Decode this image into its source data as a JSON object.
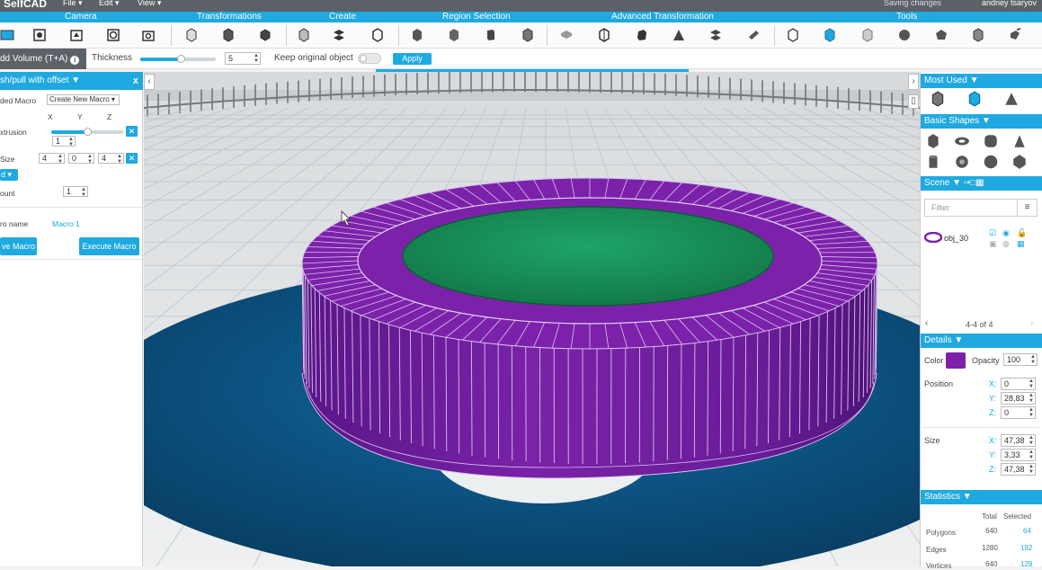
{
  "app": {
    "logo": "SelfCAD",
    "menus": [
      "File ▾",
      "Edit ▾",
      "View ▾"
    ],
    "saving": "Saving changes",
    "user": "andriey tsaryov"
  },
  "sections": [
    "Camera",
    "Transformations",
    "Create",
    "Region Selection",
    "Advanced Transformation",
    "Tools"
  ],
  "optbar": {
    "mode": "dd Volume (T+A)",
    "thickness_label": "Thickness",
    "thickness_value": "5",
    "keep_label": "Keep original object",
    "apply_label": "Apply"
  },
  "left": {
    "title": "sh/pull with offset ▼",
    "close": "x",
    "macro_label": "ded Macro",
    "macro_select": "Create New Macro ▾",
    "axes": [
      "X",
      "Y",
      "Z"
    ],
    "extrusion_label": "xtrusion",
    "extrusion_value": "1",
    "size_label": "Size",
    "size_values": [
      "4",
      "0",
      "4"
    ],
    "mode_button": "d ▾",
    "count_label": "ount",
    "count_value": "1",
    "macro_name_label": "ro name",
    "macro_name_value": "Macro 1",
    "save_macro": "ve Macro",
    "execute_macro": "Execute Macro"
  },
  "right": {
    "most_used": "Most Used ▼",
    "basic_shapes": "Basic Shapes ▼",
    "scene": "Scene ▼",
    "filter_placeholder": "Filter",
    "object_name": "obj_30",
    "pager": "4-4 of 4",
    "details": "Details ▼",
    "color_label": "Color",
    "color_value": "#7b22a8",
    "opacity_label": "Opacity",
    "opacity_value": "100",
    "position_label": "Position",
    "position": {
      "x": "0",
      "y": "28,83",
      "z": "0"
    },
    "size_label": "Size",
    "size": {
      "x": "47,38",
      "y": "3,33",
      "z": "47,38"
    },
    "statistics": "Statistics ▼",
    "stats_total": "Total",
    "stats_selected": "Selected",
    "stats": [
      {
        "label": "Polygons",
        "total": "640",
        "selected": "64"
      },
      {
        "label": "Edges",
        "total": "1280",
        "selected": "192"
      },
      {
        "label": "Vertices",
        "total": "640",
        "selected": "128"
      }
    ]
  },
  "colors": {
    "accent": "#1fa9e0",
    "object_purple": "#7b22a8",
    "object_top": "#1f9a5e",
    "floor_blue": "#0d4f7c"
  }
}
